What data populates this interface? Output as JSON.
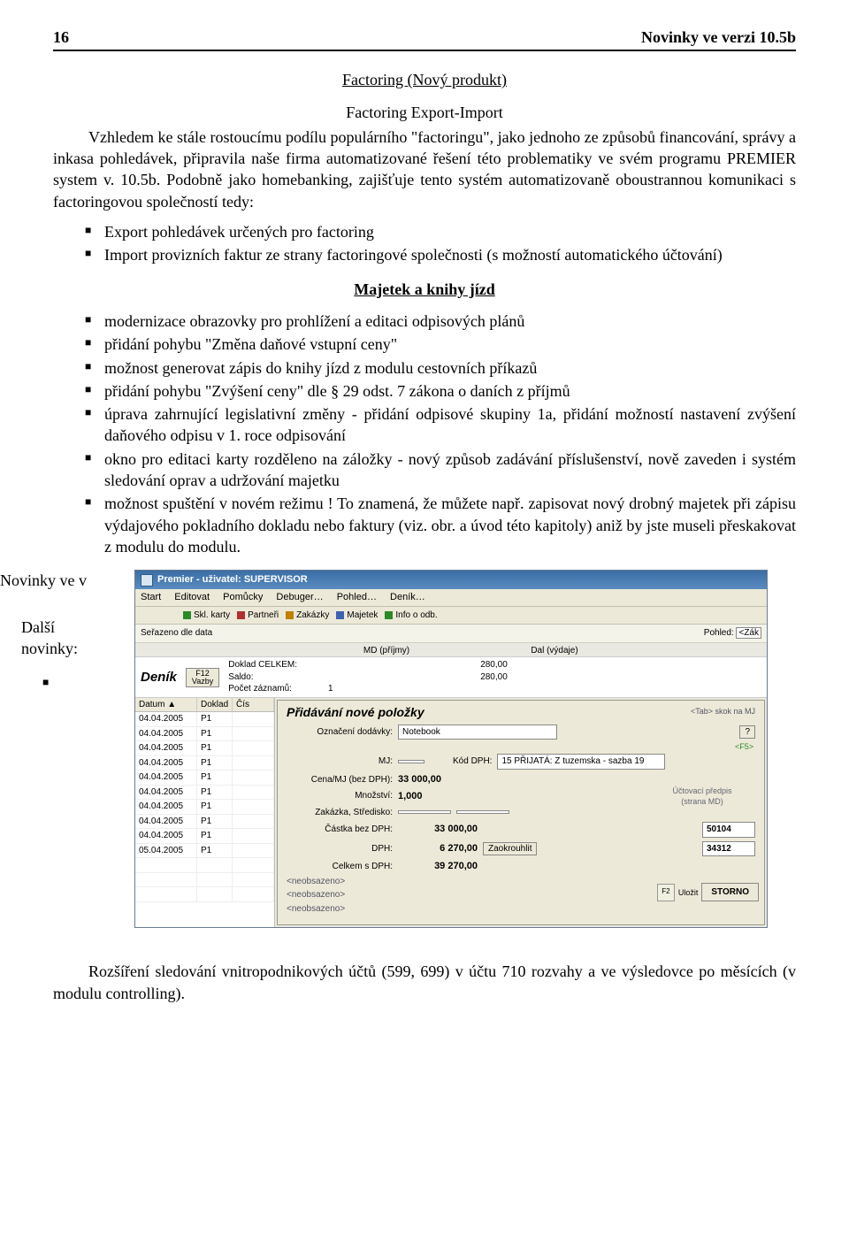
{
  "header": {
    "page_number": "16",
    "title": "Novinky ve verzi 10.5b"
  },
  "section1": {
    "title": "Factoring  (Nový produkt)",
    "subtitle": "Factoring Export-Import",
    "paragraph": "Vzhledem ke stále rostoucímu podílu populárního \"factoringu\", jako jednoho ze způsobů financování, správy a inkasa pohledávek, připravila naše firma automatizované řešení této problematiky ve svém programu PREMIER system v. 10.5b. Podobně jako homebanking, zajišťuje tento systém automatizovaně oboustrannou komunikaci s factoringovou společností tedy:",
    "bullets": [
      "Export pohledávek určených pro factoring",
      "Import provizních faktur ze strany factoringové společnosti (s možností automatického účtování)"
    ]
  },
  "section2": {
    "title": "Majetek a knihy jízd",
    "bullets": [
      "modernizace obrazovky pro prohlížení a editaci odpisových plánů",
      "přidání pohybu \"Změna daňové vstupní ceny\"",
      "možnost generovat zápis do knihy jízd z modulu cestovních příkazů",
      "přidání pohybu \"Zvýšení ceny\" dle § 29 odst. 7 zákona o daních z příjmů",
      "úprava zahrnující legislativní změny - přidání odpisové skupiny 1a, přidání možností nastavení zvýšení daňového odpisu v 1. roce odpisování",
      "okno pro editaci karty rozděleno na záložky - nový způsob zadávání příslušenství, nově zaveden i systém sledování oprav a udržování majetku",
      "možnost spuštění v novém režimu ! To znamená, že můžete např. zapisovat nový drobný majetek při zápisu výdajového pokladního dokladu nebo faktury (viz. obr. a úvod této kapitoly) aniž by jste museli přeskakovat z modulu do modulu."
    ]
  },
  "left_fragment": {
    "line1": "Novinky ve v",
    "line2": "Další",
    "line3": "novinky:",
    "square": "■"
  },
  "app": {
    "title": "Premier - uživatel: SUPERVISOR",
    "menu": [
      "Start",
      "Editovat",
      "Pomůcky",
      "Debuger…",
      "Pohled…",
      "Deník…"
    ],
    "tabs": [
      {
        "label": "Skl. karty",
        "color": "#2a8a2a"
      },
      {
        "label": "Partneři",
        "color": "#b03030"
      },
      {
        "label": "Zakázky",
        "color": "#c08000"
      },
      {
        "label": "Majetek",
        "color": "#4060b0"
      },
      {
        "label": "Info o odb.",
        "color": "#2a8a2a"
      }
    ],
    "sort_label": "Seřazeno dle data",
    "pohled_label": "Pohled:",
    "pohled_value": "<Zák",
    "doc_header": {
      "md": "MD (příjmy)",
      "dal": "Dal (výdaje)"
    },
    "doc_lines": [
      {
        "label": "Doklad CELKEM:",
        "md": "",
        "dal": "280,00"
      },
      {
        "label": "Saldo:",
        "md": "",
        "dal": "280,00"
      },
      {
        "label": "Počet záznamů:",
        "md": "1",
        "dal": ""
      }
    ],
    "denik_label": "Deník",
    "f12": {
      "top": "F12",
      "bottom": "Vazby"
    },
    "grid": {
      "headers": {
        "datum": "Datum ▲",
        "doklad": "Doklad",
        "cis": "Čís"
      },
      "rows": [
        {
          "datum": "04.04.2005",
          "doklad": "P1"
        },
        {
          "datum": "04.04.2005",
          "doklad": "P1"
        },
        {
          "datum": "04.04.2005",
          "doklad": "P1"
        },
        {
          "datum": "04.04.2005",
          "doklad": "P1"
        },
        {
          "datum": "04.04.2005",
          "doklad": "P1"
        },
        {
          "datum": "04.04.2005",
          "doklad": "P1"
        },
        {
          "datum": "04.04.2005",
          "doklad": "P1"
        },
        {
          "datum": "04.04.2005",
          "doklad": "P1"
        },
        {
          "datum": "04.04.2005",
          "doklad": "P1"
        },
        {
          "datum": "05.04.2005",
          "doklad": "P1"
        }
      ]
    },
    "form": {
      "title": "Přidávání nové položky",
      "oznaceni_label": "Označení dodávky:",
      "oznaceni_value": "Notebook",
      "tab_hint": "<Tab> skok na MJ",
      "q_button": "?",
      "f5_hint": "<F5>",
      "mj_label": "MJ:",
      "kod_dph_label": "Kód DPH:",
      "kod_dph_value": "15 PŘIJATÁ: Z tuzemska - sazba 19",
      "cena_mj_label": "Cena/MJ (bez DPH):",
      "cena_mj_value": "33 000,00",
      "mnozstvi_label": "Množství:",
      "mnozstvi_value": "1,000",
      "zakazka_label": "Zakázka, Středisko:",
      "predpis_title": "Účtovací předpis",
      "predpis_sub": "(strana MD)",
      "castka_bez_label": "Částka bez DPH:",
      "castka_bez_value": "33 000,00",
      "predpis_acc1": "50104",
      "dph_label": "DPH:",
      "dph_value": "6 270,00",
      "zaokrouhlit": "Zaokrouhlit",
      "predpis_acc2": "34312",
      "celkem_label": "Celkem s DPH:",
      "celkem_value": "39 270,00",
      "neobsazeno": "<neobsazeno>",
      "ulozit_f2": "F2",
      "ulozit_label": "Uložit",
      "storno": "STORNO"
    }
  },
  "footer": {
    "text": "Rozšíření sledování vnitropodnikových účtů (599, 699) v účtu 710 rozvahy a ve výsledovce po měsících (v modulu controlling)."
  }
}
